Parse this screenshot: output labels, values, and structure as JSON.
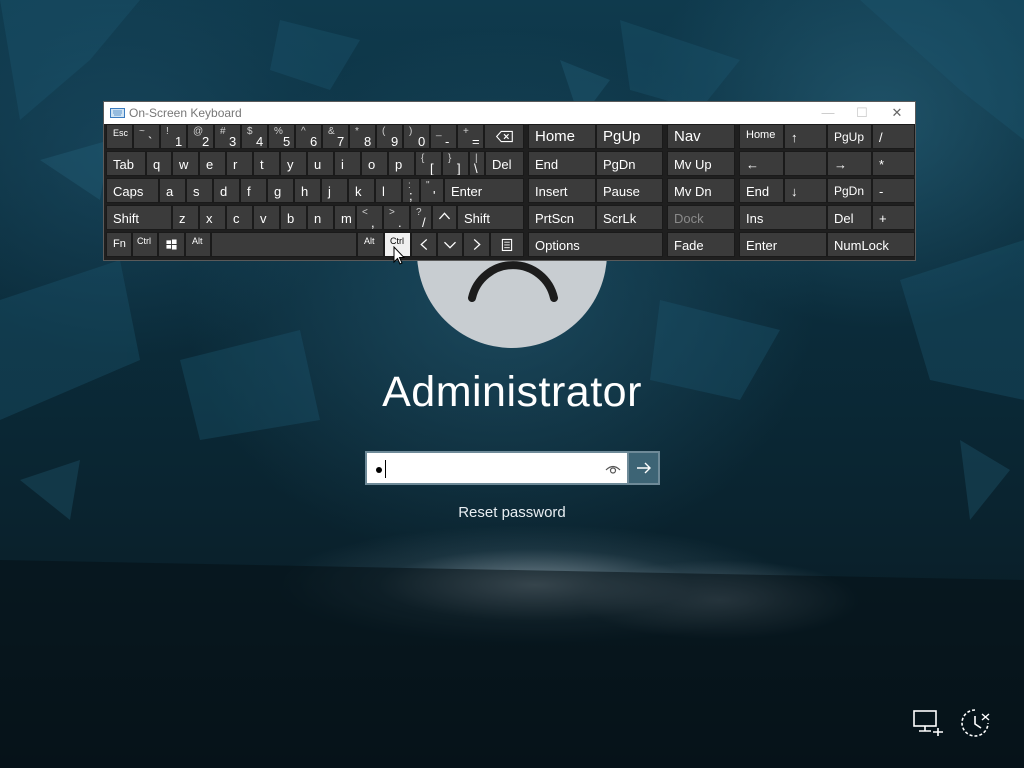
{
  "login": {
    "username": "Administrator",
    "password_value": "●",
    "reset_password_label": "Reset password"
  },
  "osk": {
    "title": "On-Screen Keyboard",
    "title_buttons": {
      "minimize": "—",
      "maximize": "☐",
      "close": "✕"
    },
    "row1": [
      {
        "label": "Esc"
      },
      {
        "shift": "~",
        "main": "`"
      },
      {
        "shift": "!",
        "main": "1"
      },
      {
        "shift": "@",
        "main": "2"
      },
      {
        "shift": "#",
        "main": "3"
      },
      {
        "shift": "$",
        "main": "4"
      },
      {
        "shift": "%",
        "main": "5"
      },
      {
        "shift": "^",
        "main": "6"
      },
      {
        "shift": "&",
        "main": "7"
      },
      {
        "shift": "*",
        "main": "8"
      },
      {
        "shift": "(",
        "main": "9"
      },
      {
        "shift": ")",
        "main": "0"
      },
      {
        "shift": "_",
        "main": "-"
      },
      {
        "shift": "+",
        "main": "="
      }
    ],
    "row2": [
      "Tab",
      "q",
      "w",
      "e",
      "r",
      "t",
      "y",
      "u",
      "i",
      "o",
      "p"
    ],
    "row2_brackets": [
      {
        "shift": "{",
        "main": "["
      },
      {
        "shift": "}",
        "main": "]"
      },
      {
        "shift": "|",
        "main": "\\"
      }
    ],
    "row2_del": "Del",
    "row3": [
      "Caps",
      "a",
      "s",
      "d",
      "f",
      "g",
      "h",
      "j",
      "k",
      "l"
    ],
    "row3_punct": [
      {
        "shift": ":",
        "main": ";"
      },
      {
        "shift": "\"",
        "main": "'"
      }
    ],
    "row3_enter": "Enter",
    "row4": [
      "Shift",
      "z",
      "x",
      "c",
      "v",
      "b",
      "n",
      "m"
    ],
    "row4_punct": [
      {
        "shift": "<",
        "main": ","
      },
      {
        "shift": ">",
        "main": "."
      },
      {
        "shift": "?",
        "main": "/"
      }
    ],
    "row4_shift_right": "Shift",
    "row5": {
      "fn": "Fn",
      "ctrl_left": "Ctrl",
      "alt_left": "Alt",
      "alt_right": "Alt",
      "ctrl_right": "Ctrl"
    },
    "nav_keys": {
      "home": "Home",
      "pgup": "PgUp",
      "nav": "Nav",
      "end": "End",
      "pgdn": "PgDn",
      "mvup": "Mv Up",
      "insert": "Insert",
      "pause": "Pause",
      "mvdn": "Mv Dn",
      "prtscn": "PrtScn",
      "scrlk": "ScrLk",
      "dock": "Dock",
      "options": "Options",
      "fade": "Fade"
    },
    "numpad": {
      "home": "Home",
      "up": "↑",
      "pgup": "PgUp",
      "div": "/",
      "left": "←",
      "right": "→",
      "mul": "*",
      "end": "End",
      "down": "↓",
      "pgdn": "PgDn",
      "minus": "-",
      "ins": "Ins",
      "del": "Del",
      "plus": "+",
      "enter": "Enter",
      "numlock": "NumLock"
    }
  }
}
